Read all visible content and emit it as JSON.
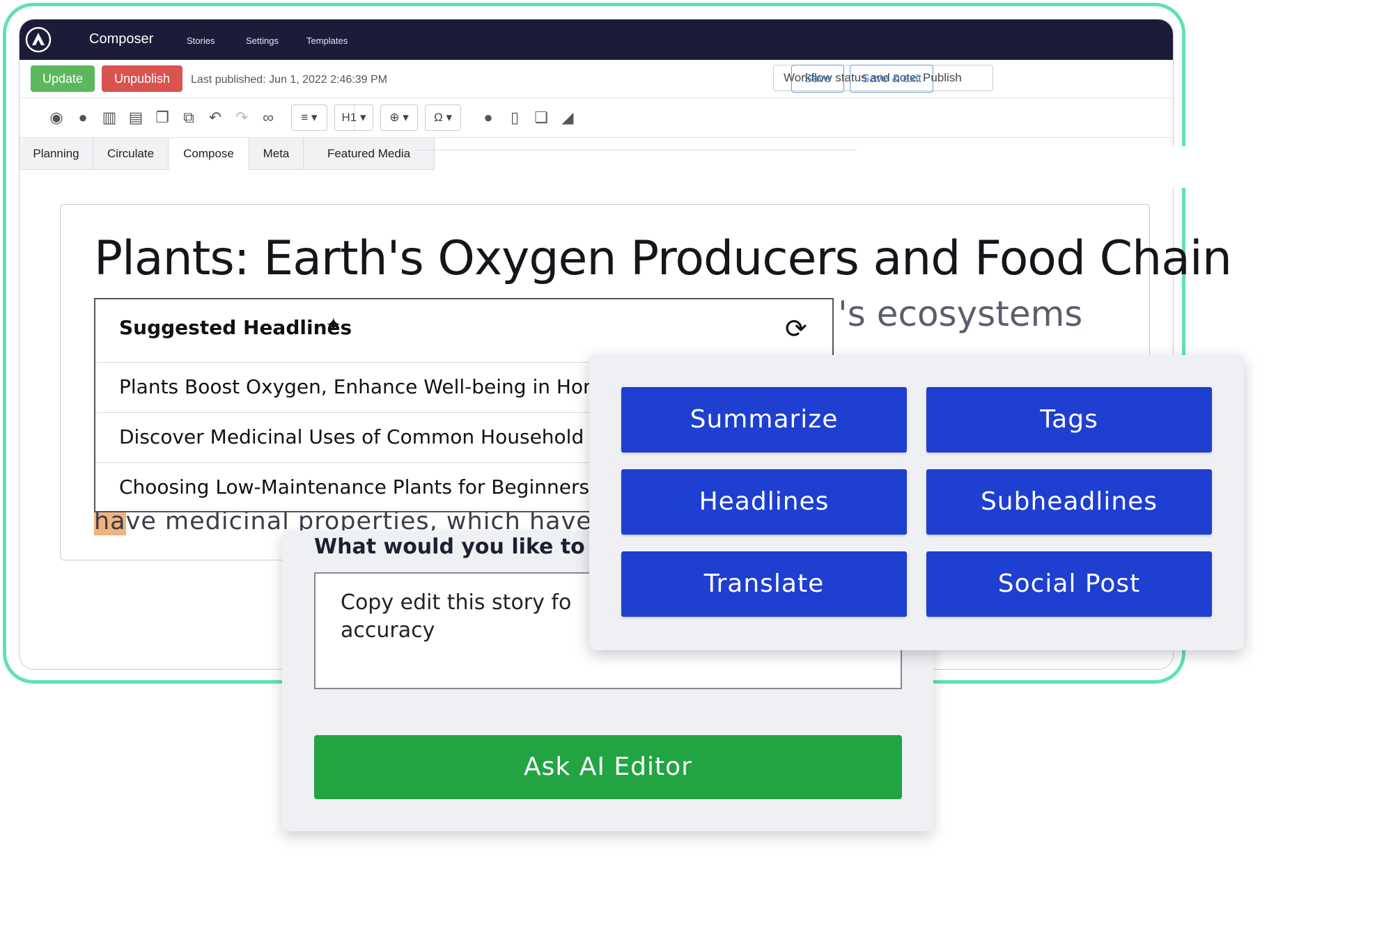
{
  "topnav": {
    "app_title": "Composer",
    "links": [
      "Stories",
      "Settings",
      "Templates"
    ]
  },
  "actionbar": {
    "update_label": "Update",
    "unpublish_label": "Unpublish",
    "last_published": "Last published: Jun 1, 2022 2:46:39 PM",
    "workflow_status": "Workflow status and note: Publish",
    "save_label": "Save",
    "save_exit_label": "Save & exit"
  },
  "toolbar": {
    "heading_select": "H1",
    "icons": [
      "eye-icon",
      "globe-icon",
      "trash-icon",
      "print-icon",
      "copy-icon",
      "duplicate-icon",
      "undo-icon",
      "redo-icon",
      "binoculars-icon",
      "align-icon",
      "link-icon",
      "omega-icon",
      "comment-icon",
      "mobile-icon",
      "paste-icon",
      "eraser-icon"
    ]
  },
  "tabs": [
    "Planning",
    "Circulate",
    "Compose",
    "Meta",
    "Featured Media"
  ],
  "article": {
    "title": "Plants: Earth's Oxygen Producers and Food Chain",
    "subtitle_visible": "'s ecosystems",
    "body_highlight": "ha",
    "body_visible": "ve medicinal properties, which have b"
  },
  "suggested": {
    "heading": "Suggested Headlines",
    "items": [
      "Plants Boost Oxygen, Enhance Well-being in Hom",
      "Discover Medicinal Uses of Common Household Pl",
      "Choosing Low-Maintenance Plants for Beginners"
    ]
  },
  "ai_editor": {
    "question": "What would you like to d",
    "prompt_text": "Copy edit this story fo\naccuracy",
    "ask_label": "Ask AI Editor"
  },
  "actions": {
    "summarize": "Summarize",
    "tags": "Tags",
    "headlines": "Headlines",
    "subheadlines": "Subheadlines",
    "translate": "Translate",
    "social_post": "Social Post"
  },
  "colors": {
    "frame_accent": "#62e0b4",
    "nav_bg": "#1c1c3a",
    "update_green": "#5cb85c",
    "unpublish_red": "#d9534f",
    "action_blue": "#1e3fcf",
    "ask_green": "#22a443",
    "highlight": "#f0b37e"
  }
}
